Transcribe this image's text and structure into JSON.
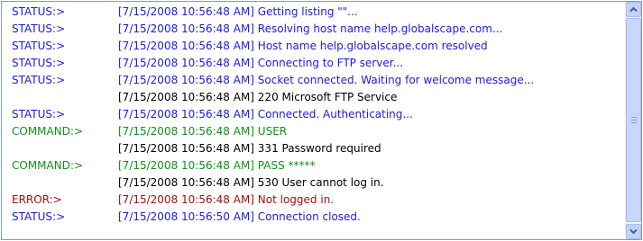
{
  "colors": {
    "status": "#1c1cd8",
    "command": "#10901a",
    "error": "#a01010",
    "response": "#000000"
  },
  "log": [
    {
      "kind": "status",
      "prefix": "STATUS:>",
      "message": "[7/15/2008 10:56:48 AM] Getting listing \"\"..."
    },
    {
      "kind": "status",
      "prefix": "STATUS:>",
      "message": "[7/15/2008 10:56:48 AM] Resolving host name help.globalscape.com..."
    },
    {
      "kind": "status",
      "prefix": "STATUS:>",
      "message": "[7/15/2008 10:56:48 AM] Host name help.globalscape.com resolved"
    },
    {
      "kind": "status",
      "prefix": "STATUS:>",
      "message": "[7/15/2008 10:56:48 AM] Connecting to FTP server..."
    },
    {
      "kind": "status",
      "prefix": "STATUS:>",
      "message": "[7/15/2008 10:56:48 AM] Socket connected. Waiting for welcome message..."
    },
    {
      "kind": "response",
      "prefix": "",
      "message": "[7/15/2008 10:56:48 AM] 220 Microsoft FTP Service"
    },
    {
      "kind": "status",
      "prefix": "STATUS:>",
      "message": "[7/15/2008 10:56:48 AM] Connected. Authenticating..."
    },
    {
      "kind": "command",
      "prefix": "COMMAND:>",
      "message": "[7/15/2008 10:56:48 AM] USER"
    },
    {
      "kind": "response",
      "prefix": "",
      "message": "[7/15/2008 10:56:48 AM] 331 Password required"
    },
    {
      "kind": "command",
      "prefix": "COMMAND:>",
      "message": "[7/15/2008 10:56:48 AM] PASS *****"
    },
    {
      "kind": "response",
      "prefix": "",
      "message": "[7/15/2008 10:56:48 AM] 530 User cannot log in."
    },
    {
      "kind": "error",
      "prefix": "ERROR:>",
      "message": "[7/15/2008 10:56:48 AM] Not logged in."
    },
    {
      "kind": "status",
      "prefix": "STATUS:>",
      "message": "[7/15/2008 10:56:50 AM] Connection closed."
    }
  ],
  "scrollbar": {
    "up_icon": "scroll-up-arrow-icon",
    "down_icon": "scroll-down-arrow-icon",
    "grip_icon": "scroll-thumb-grip-icon"
  }
}
